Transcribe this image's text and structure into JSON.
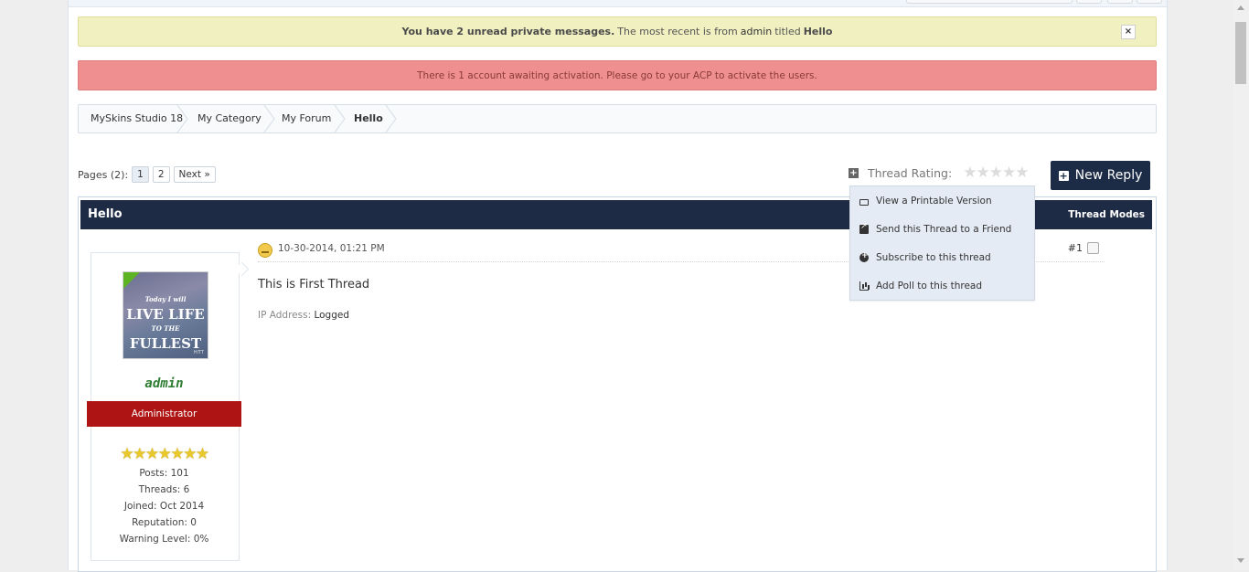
{
  "notice_pm": {
    "prefix": "You have 2 unread private messages.",
    "middle": "The most recent is from",
    "sender": "admin",
    "titled": "titled",
    "subject": "Hello",
    "close": "×"
  },
  "notice_activation": {
    "text": "There is 1 account awaiting activation. Please go to your ACP to activate the users."
  },
  "breadcrumb": [
    {
      "label": "MySkins Studio 18"
    },
    {
      "label": "My Category"
    },
    {
      "label": "My Forum"
    },
    {
      "label": "Hello"
    }
  ],
  "pagination": {
    "label": "Pages (2):",
    "pages": [
      "1",
      "2"
    ],
    "next": "Next »",
    "current": "1"
  },
  "rating": {
    "label": "Thread Rating:",
    "stars_filled": 0,
    "stars_total": 5
  },
  "new_reply": {
    "label": "New Reply"
  },
  "tools_menu": {
    "items": [
      {
        "label": "View a Printable Version",
        "icon": "printer-icon"
      },
      {
        "label": "Send this Thread to a Friend",
        "icon": "send-icon"
      },
      {
        "label": "Subscribe to this thread",
        "icon": "subscribe-icon"
      },
      {
        "label": "Add Poll to this thread",
        "icon": "poll-icon"
      }
    ]
  },
  "thread": {
    "title": "Hello",
    "modes": "Thread Modes"
  },
  "author": {
    "avatar_text_small": "Today I will",
    "avatar_text_line1": "LIVE LIFE",
    "avatar_text_line2": "TO THE",
    "avatar_text_line3": "FULLEST",
    "avatar_text_tiny": "HITT",
    "username": "admin",
    "usertitle": "Administrator",
    "stars": 7,
    "posts": "Posts: 101",
    "threads": "Threads: 6",
    "joined": "Joined: Oct 2014",
    "reputation": "Reputation: 0",
    "warning": "Warning Level: 0%"
  },
  "post": {
    "date": "10-30-2014, 01:21 PM",
    "number": "#1",
    "body": "This is First Thread",
    "ip_label": "IP Address:",
    "ip_value": "Logged"
  },
  "colors": {
    "header_navy": "#1e2b45",
    "usertitle_red": "#ae1414",
    "notice_yellow": "#f1f0c1",
    "notice_red": "#ef8f8f",
    "username_green": "#2e7d32",
    "menu_bg": "#e5ebf4"
  }
}
